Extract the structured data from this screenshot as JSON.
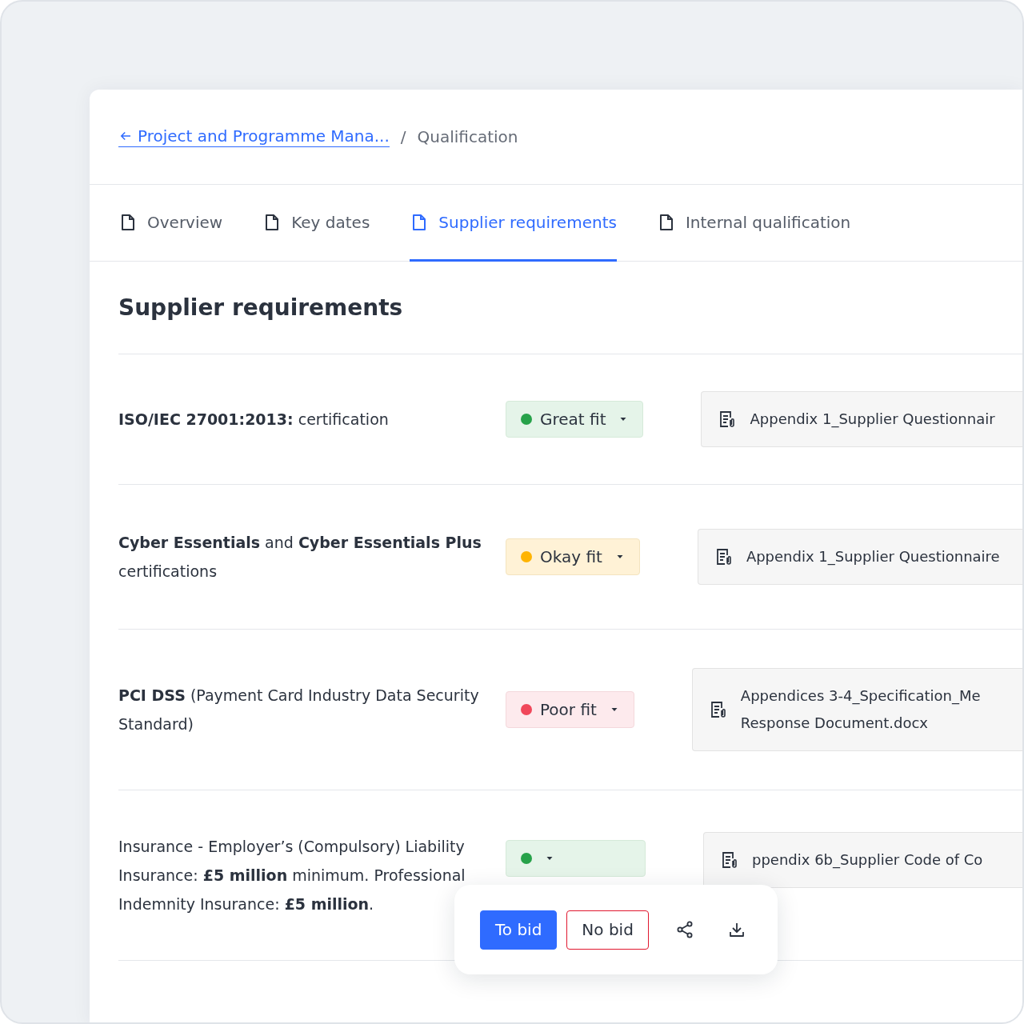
{
  "breadcrumb": {
    "back_link": "Project and Programme Mana...",
    "separator": "/",
    "current": "Qualification"
  },
  "tabs": [
    {
      "label": "Overview",
      "selected": false
    },
    {
      "label": "Key dates",
      "selected": false
    },
    {
      "label": "Supplier requirements",
      "selected": true
    },
    {
      "label": "Internal qualification",
      "selected": false
    }
  ],
  "heading": "Supplier requirements",
  "requirements": [
    {
      "text": "**ISO/IEC 27001:2013:** certification",
      "fit": {
        "kind": "great",
        "label": "Great fit"
      },
      "files": [
        "Appendix 1_Supplier Questionnair"
      ]
    },
    {
      "text": "**Cyber Essentials** and **Cyber Essentials Plus** certifications",
      "fit": {
        "kind": "okay",
        "label": "Okay fit"
      },
      "files": [
        "Appendix 1_Supplier Questionnaire"
      ]
    },
    {
      "text": "**PCI DSS** (Payment Card Industry Data Security Standard)",
      "fit": {
        "kind": "poor",
        "label": "Poor fit"
      },
      "files": [
        "Appendices 3-4_Specification_Me",
        "Response Document.docx"
      ]
    },
    {
      "text": "Insurance - Employer’s (Compulsory) Liability Insurance: **£5 million** minimum. Professional Indemnity Insurance: **£5 million**.",
      "fit": {
        "kind": "great"
      },
      "files": [
        "ppendix 6b_Supplier Code of Co"
      ]
    }
  ],
  "action_bar": {
    "primary": "To bid",
    "secondary": "No bid"
  }
}
